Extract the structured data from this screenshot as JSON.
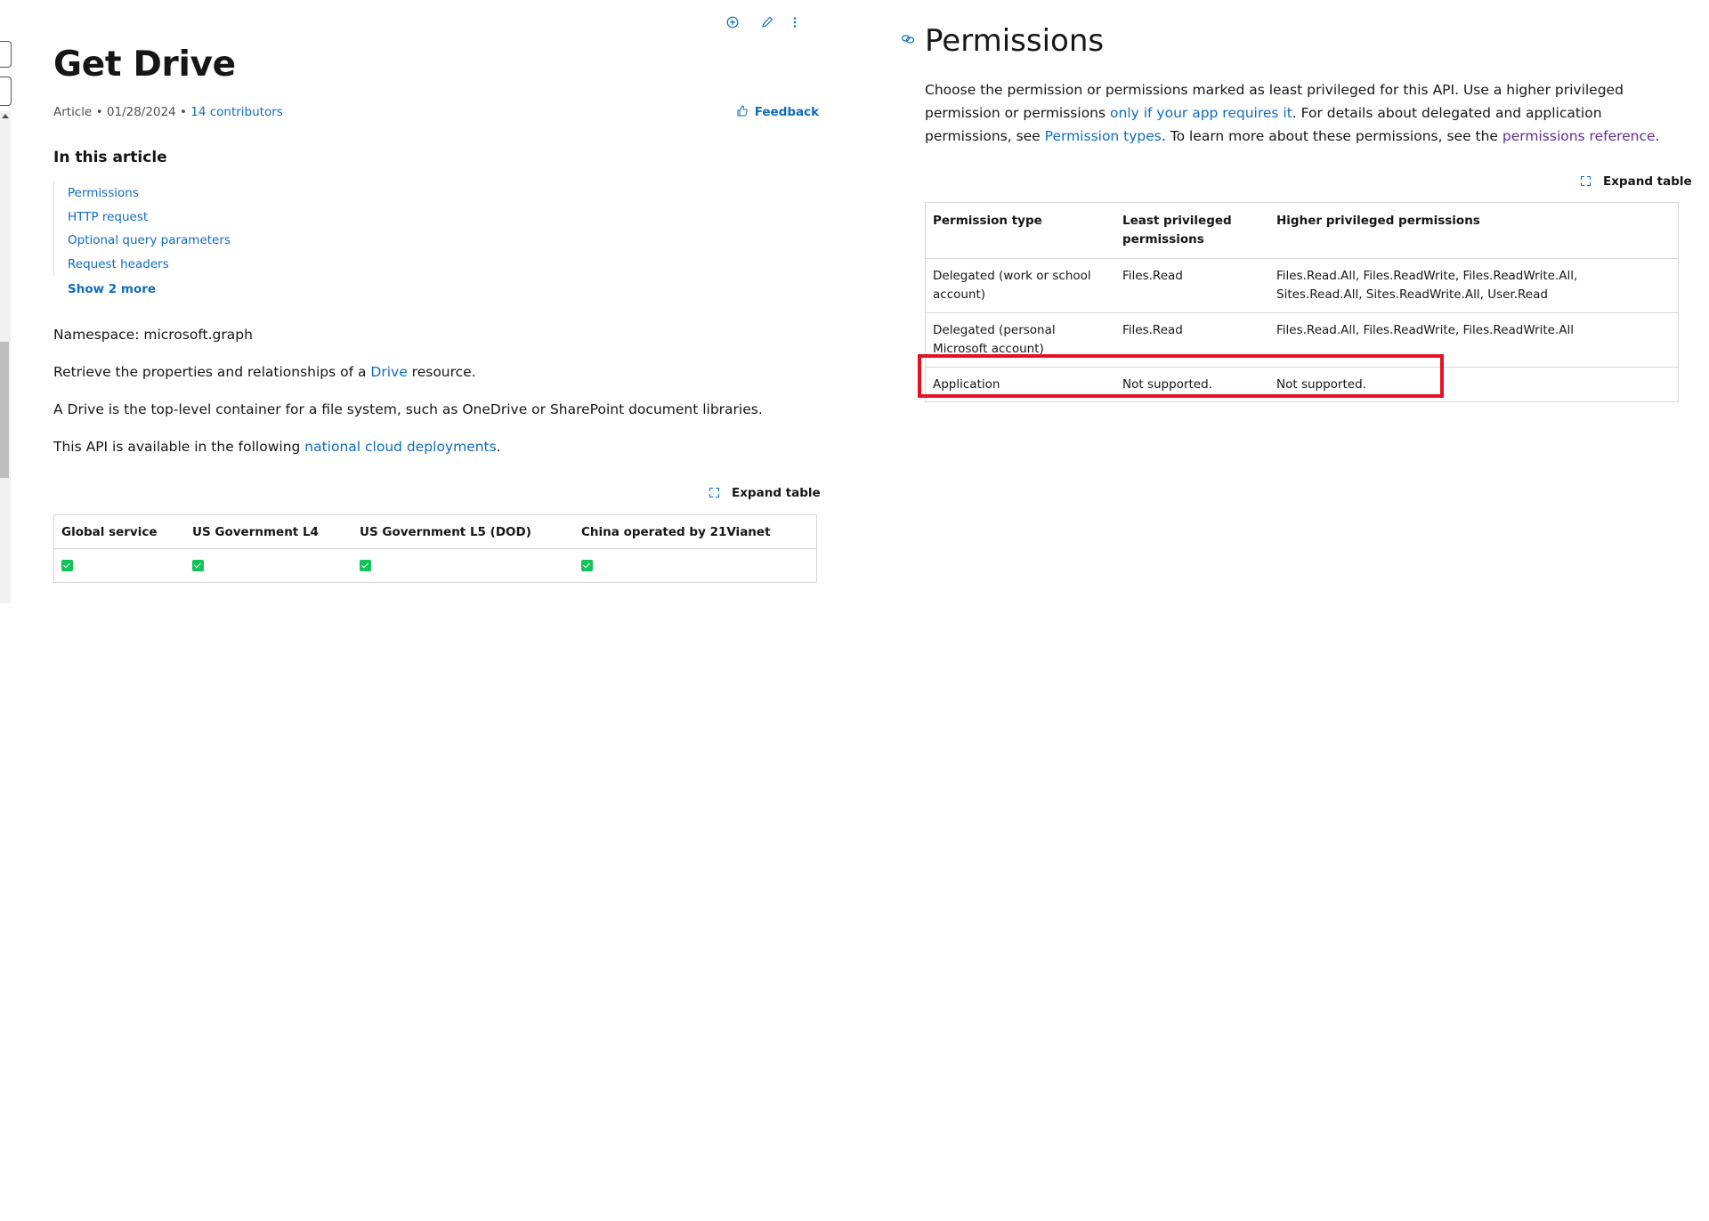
{
  "top_icons": {
    "add": "circle-plus-icon",
    "edit": "pencil-icon",
    "more": "more-vertical-icon"
  },
  "article": {
    "title": "Get Drive",
    "meta": {
      "type": "Article",
      "date": "01/28/2024",
      "contributors": "14 contributors"
    },
    "feedback_label": "Feedback",
    "in_this_article": {
      "heading": "In this article",
      "items": [
        "Permissions",
        "HTTP request",
        "Optional query parameters",
        "Request headers"
      ],
      "show_more": "Show 2 more"
    },
    "namespace": "Namespace: microsoft.graph",
    "p1": {
      "before": "Retrieve the properties and relationships of a ",
      "link": "Drive",
      "after": " resource."
    },
    "p2": "A Drive is the top-level container for a file system, such as OneDrive or SharePoint document libraries.",
    "p3": {
      "before": "This API is available in the following ",
      "link": "national cloud deployments",
      "after": "."
    },
    "expand_table": "Expand table",
    "cloud_table": {
      "headers": [
        "Global service",
        "US Government L4",
        "US Government L5 (DOD)",
        "China operated by 21Vianet"
      ],
      "values": [
        "supported",
        "supported",
        "supported",
        "supported"
      ]
    }
  },
  "permissions": {
    "heading": "Permissions",
    "intro": {
      "t1": "Choose the permission or permissions marked as least privileged for this API. Use a higher privileged permission or permissions ",
      "l1": "only if your app requires it",
      "t2": ". For details about delegated and application permissions, see ",
      "l2": "Permission types",
      "t3": ". To learn more about these permissions, see the ",
      "l3": "permissions reference",
      "t4": "."
    },
    "expand_table": "Expand table",
    "table": {
      "headers": [
        "Permission type",
        "Least privileged permissions",
        "Higher privileged permissions"
      ],
      "rows": [
        [
          "Delegated (work or school account)",
          "Files.Read",
          "Files.Read.All, Files.ReadWrite, Files.ReadWrite.All, Sites.Read.All, Sites.ReadWrite.All, User.Read"
        ],
        [
          "Delegated (personal Microsoft account)",
          "Files.Read",
          "Files.Read.All, Files.ReadWrite, Files.ReadWrite.All"
        ],
        [
          "Application",
          "Not supported.",
          "Not supported."
        ]
      ]
    },
    "highlight_color": "#e81123"
  },
  "colors": {
    "link": "#0f6cbd",
    "visited_link": "#5c2e91",
    "check": "#13c25b"
  }
}
